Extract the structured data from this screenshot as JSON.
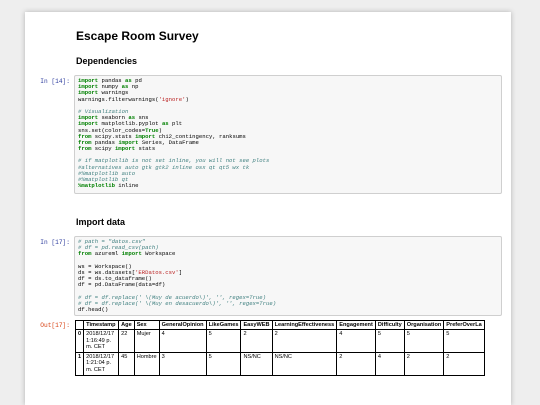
{
  "notebook": {
    "title": "Escape Room Survey",
    "sections": {
      "dependencies": "Dependencies",
      "import_data": "Import data"
    },
    "prompts": {
      "in14": "In [14]:",
      "in17": "In [17]:",
      "out17": "Out[17]:"
    },
    "cell1_lines": [
      "import pandas as pd",
      "import numpy as np",
      "import warnings",
      "warnings.filterwarnings('ignore')",
      "",
      "# Visualization",
      "import seaborn as sns",
      "import matplotlib.pyplot as plt",
      "sns.set(color_codes=True)",
      "from scipy.stats import chi2_contingency, ranksums",
      "from pandas import Series, DataFrame",
      "from scipy import stats",
      "",
      "# if matplotlib is not set inline, you will not see plots",
      "#alternatives auto gtk gtk2 inline osx qt qt5 wx tk",
      "#%matplotlib auto",
      "#%matplotlib qt",
      "%matplotlib inline"
    ],
    "cell2_lines": [
      "# path = \"datos.csv\"",
      "# df = pd.read_csv(path)",
      "from azureml import Workspace",
      "",
      "ws = Workspace()",
      "ds = ws.datasets['ERDatos.csv']",
      "df = ds.to_dataframe()",
      "df = pd.DataFrame(data=df)",
      "",
      "# df = df.replace(' \\(Muy de acuerdo\\)', '', regex=True)",
      "# df = df.replace(' \\(Muy en desacuerdo\\)', '', regex=True)",
      "df.head()"
    ],
    "table": {
      "columns": [
        "",
        "Timestamp",
        "Age",
        "Sex",
        "GeneralOpinion",
        "LikeGames",
        "EasyWEB",
        "LearningEffectiveness",
        "Engagement",
        "Difficulty",
        "Organisation",
        "PreferOverLa"
      ],
      "rows": [
        [
          "0",
          "2018/12/17 1:16:49 p. m. CET",
          "22",
          "Mujer",
          "4",
          "5",
          "2",
          "2",
          "4",
          "5",
          "5",
          "5"
        ],
        [
          "1",
          "2018/12/17 1:21:04 p. m. CET",
          "45",
          "Hombre",
          "3",
          "5",
          "NS/NC",
          "NS/NC",
          "2",
          "4",
          "2",
          "2"
        ]
      ]
    }
  }
}
